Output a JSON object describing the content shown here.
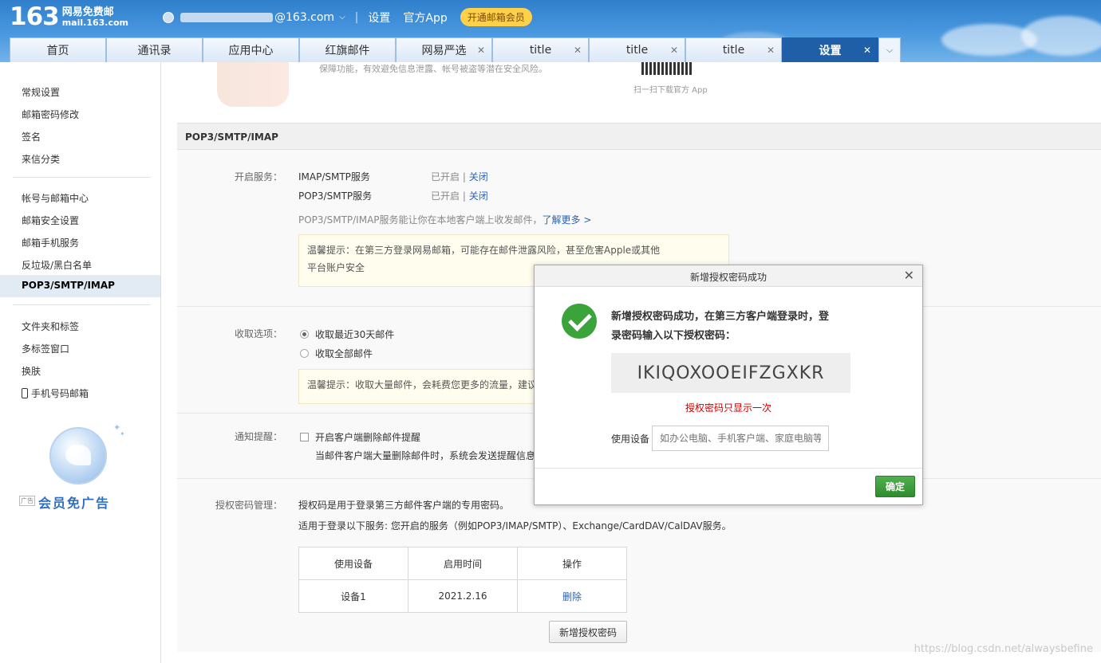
{
  "header": {
    "logo_number": "163",
    "logo_cn": "网易免费邮",
    "logo_en": "mail.163.com",
    "account_suffix": "@163.com",
    "links": [
      "设置",
      "官方App"
    ],
    "vip_button": "开通邮箱会员"
  },
  "tabs": [
    {
      "label": "首页",
      "closable": false
    },
    {
      "label": "通讯录",
      "closable": false
    },
    {
      "label": "应用中心",
      "closable": false
    },
    {
      "label": "红旗邮件",
      "closable": false
    },
    {
      "label": "网易严选",
      "closable": true
    },
    {
      "label": "title",
      "closable": true
    },
    {
      "label": "title",
      "closable": true
    },
    {
      "label": "title",
      "closable": true
    },
    {
      "label": "设置",
      "closable": true,
      "active": true
    }
  ],
  "sidebar": {
    "group1": [
      "常规设置",
      "邮箱密码修改",
      "签名",
      "来信分类"
    ],
    "group2": [
      "帐号与邮箱中心",
      "邮箱安全设置",
      "邮箱手机服务",
      "反垃圾/黑白名单",
      "POP3/SMTP/IMAP"
    ],
    "group3": [
      "文件夹和标签",
      "多标签窗口",
      "换肤",
      "手机号码邮箱"
    ],
    "ad_text": "会员免广告",
    "ad_tag": "广告"
  },
  "promo": {
    "text": "保障功能，有效避免信息泄露、帐号被盗等潜在安全风险。",
    "qr_caption": "扫一扫下载官方 App"
  },
  "section": {
    "title": "POP3/SMTP/IMAP",
    "service_label": "开启服务：",
    "services": [
      {
        "name": "IMAP/SMTP服务",
        "status": "已开启",
        "action": "关闭"
      },
      {
        "name": "POP3/SMTP服务",
        "status": "已开启",
        "action": "关闭"
      }
    ],
    "service_desc": "POP3/SMTP/IMAP服务能让你在本地客户端上收发邮件，",
    "learn_more": "了解更多 >",
    "tip1_line1": "温馨提示：在第三方登录网易邮箱，可能存在邮件泄露风险，甚至危害Apple或其他",
    "tip1_line2": "平台账户安全",
    "receive_label": "收取选项：",
    "receive_options": [
      "收取最近30天邮件",
      "收取全部邮件"
    ],
    "tip2": "温馨提示：收取大量邮件，会耗费您更多的流量，建议",
    "notify_label": "通知提醒：",
    "notify_option": "开启客户端删除邮件提醒",
    "notify_desc": "当邮件客户端大量删除邮件时，系统会发送提醒信息",
    "auth_label": "授权密码管理：",
    "auth_desc": "授权码是用于登录第三方邮件客户端的专用密码。",
    "auth_desc2": "适用于登录以下服务: 您开启的服务（例如POP3/IMAP/SMTP）、Exchange/CardDAV/CalDAV服务。",
    "table_headers": [
      "使用设备",
      "启用时间",
      "操作"
    ],
    "table_rows": [
      {
        "device": "设备1",
        "time": "2021.2.16",
        "action": "删除"
      }
    ],
    "new_button": "新增授权密码"
  },
  "dialog": {
    "title": "新增授权密码成功",
    "message_line1": "新增授权密码成功，在第三方客户端登录时，登",
    "message_line2": "录密码输入以下授权密码：",
    "code": "IKIQOXOOEIFZGXKR",
    "once_note": "授权密码只显示一次",
    "device_label": "使用设备",
    "device_placeholder": "如办公电脑、手机客户端、家庭电脑等",
    "ok_button": "确定"
  },
  "watermark": "https://blog.csdn.net/alwaysbefine"
}
